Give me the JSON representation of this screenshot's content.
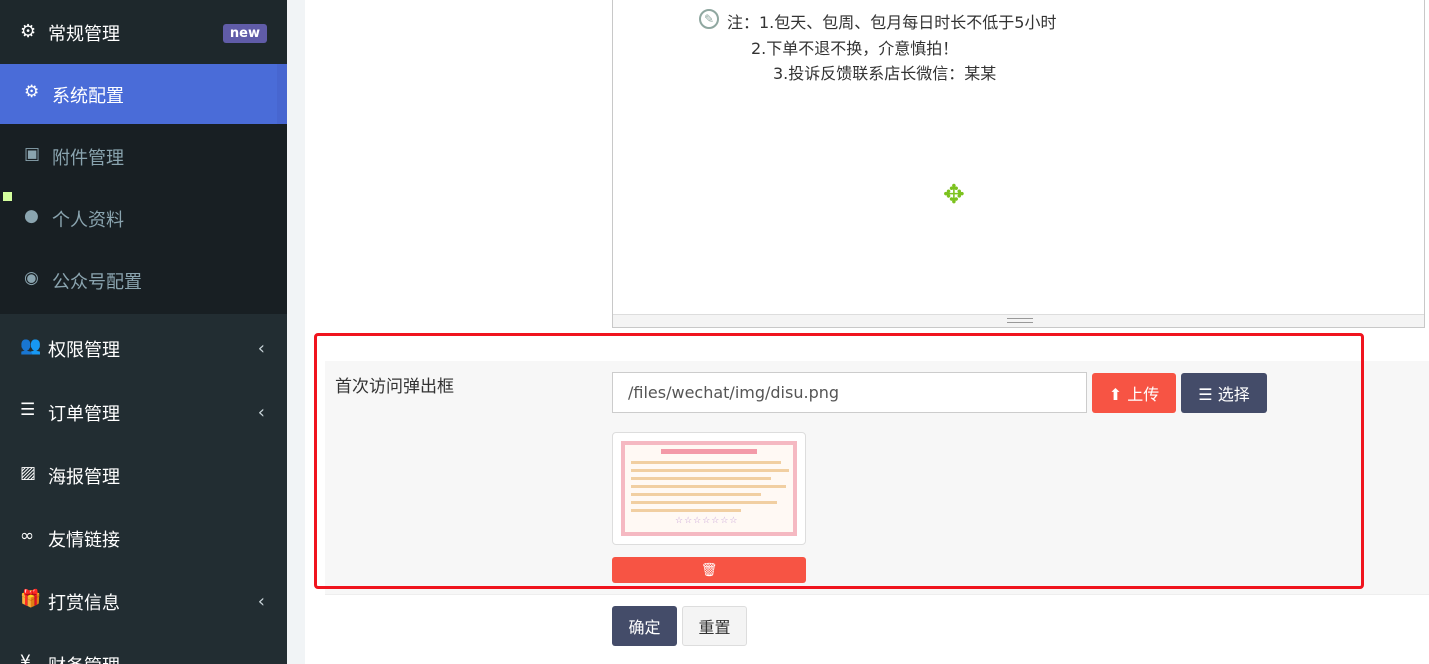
{
  "sidebar": {
    "header": {
      "label": "常规管理",
      "badge": "new",
      "icon": "gears-icon"
    },
    "sub_items": [
      {
        "label": "系统配置",
        "icon": "gear-icon",
        "active": true
      },
      {
        "label": "附件管理",
        "icon": "image-file-icon"
      },
      {
        "label": "个人资料",
        "icon": "user-icon"
      },
      {
        "label": "公众号配置",
        "icon": "wechat-icon"
      }
    ],
    "nav_items": [
      {
        "label": "权限管理",
        "icon": "users-icon",
        "has_children": true
      },
      {
        "label": "订单管理",
        "icon": "list-icon",
        "has_children": true
      },
      {
        "label": "海报管理",
        "icon": "picture-icon",
        "has_children": false
      },
      {
        "label": "友情链接",
        "icon": "link-icon",
        "has_children": false
      },
      {
        "label": "打赏信息",
        "icon": "gift-icon",
        "has_children": true
      },
      {
        "label": "财务管理",
        "icon": "money-icon",
        "has_children": false
      }
    ],
    "chevron": "‹"
  },
  "editor": {
    "lines": [
      "注：1.包天、包周、包月每日时长不低于5小时",
      "2.下单不退不换，介意慎拍！",
      "3.投诉反馈联系店长微信：某某"
    ]
  },
  "form": {
    "popup_label": "首次访问弹出框",
    "popup_value": "/files/wechat/img/disu.png",
    "upload_label": "上传",
    "select_label": "选择",
    "confirm_label": "确定",
    "reset_label": "重置"
  },
  "colors": {
    "sidebar_bg": "#222d32",
    "active_bg": "#4a6cd8",
    "badge_bg": "#605ca8",
    "danger": "#f75444",
    "dark_button": "#444c69",
    "highlight_border": "#f0141e"
  }
}
